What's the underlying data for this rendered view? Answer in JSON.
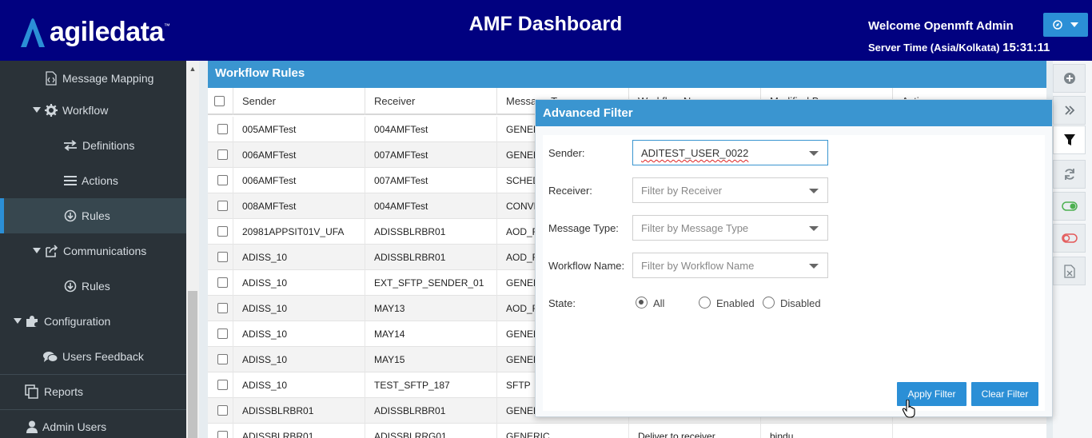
{
  "header": {
    "logo_text": "agiledata",
    "logo_tm": "™",
    "title": "AMF Dashboard",
    "welcome": "Welcome Openmft Admin",
    "server_time_label": "Server Time (Asia/Kolkata)",
    "server_time": "15:31:11",
    "brand_color": "#010180"
  },
  "sidebar": {
    "items": [
      {
        "label": "Message Mapping",
        "icon": "code-file-icon"
      },
      {
        "label": "Workflow",
        "icon": "gear-icon"
      },
      {
        "label": "Definitions",
        "icon": "exchange-arrows-icon"
      },
      {
        "label": "Actions",
        "icon": "list-icon"
      },
      {
        "label": "Rules",
        "icon": "circle-down-icon",
        "active": true
      },
      {
        "label": "Communications",
        "icon": "share-icon"
      },
      {
        "label": "Rules",
        "icon": "circle-down-icon"
      },
      {
        "label": "Configuration",
        "icon": "puzzle-icon"
      },
      {
        "label": "Users Feedback",
        "icon": "comments-icon"
      },
      {
        "label": "Reports",
        "icon": "copy-icon"
      },
      {
        "label": "Admin Users",
        "icon": "user-icon"
      }
    ]
  },
  "panel": {
    "title": "Workflow Rules",
    "columns": [
      "Sender",
      "Receiver",
      "Message Type",
      "Workflow Name",
      "Modified By",
      "Actions"
    ],
    "rows": [
      {
        "sender": "005AMFTest",
        "receiver": "004AMFTest",
        "msg_type": "GENERIC"
      },
      {
        "sender": "006AMFTest",
        "receiver": "007AMFTest",
        "msg_type": "GENERIC"
      },
      {
        "sender": "006AMFTest",
        "receiver": "007AMFTest",
        "msg_type": "SCHEDULER"
      },
      {
        "sender": "008AMFTest",
        "receiver": "004AMFTest",
        "msg_type": "CONVERSION"
      },
      {
        "sender": "20981APPSIT01V_UFA",
        "receiver": "ADISSBLRBR01",
        "msg_type": "AOD_FILE"
      },
      {
        "sender": "ADISS_10",
        "receiver": "ADISSBLRBR01",
        "msg_type": "AOD_FILE"
      },
      {
        "sender": "ADISS_10",
        "receiver": "EXT_SFTP_SENDER_01",
        "msg_type": "GENERIC"
      },
      {
        "sender": "ADISS_10",
        "receiver": "MAY13",
        "msg_type": "AOD_FILE"
      },
      {
        "sender": "ADISS_10",
        "receiver": "MAY14",
        "msg_type": "GENERIC"
      },
      {
        "sender": "ADISS_10",
        "receiver": "MAY15",
        "msg_type": "GENERIC"
      },
      {
        "sender": "ADISS_10",
        "receiver": "TEST_SFTP_187",
        "msg_type": "SFTP"
      },
      {
        "sender": "ADISSBLRBR01",
        "receiver": "ADISSBLRBR01",
        "msg_type": "GENERIC"
      },
      {
        "sender": "ADISSBLRBR01",
        "receiver": "ADISSBLRRG01",
        "msg_type": "GENERIC",
        "workflow": "Deliver to receiver",
        "modified_by": "bindu"
      }
    ]
  },
  "toolbar": {
    "buttons": [
      "add-icon",
      "double-chevron-right-icon",
      "filter-icon",
      "refresh-icon",
      "toggle-on-icon",
      "toggle-off-icon",
      "excel-icon"
    ]
  },
  "filter_dialog": {
    "title": "Advanced Filter",
    "sender_label": "Sender:",
    "sender_value": "ADITEST_USER_0022",
    "receiver_label": "Receiver:",
    "receiver_placeholder": "Filter by Receiver",
    "msg_type_label": "Message Type:",
    "msg_type_placeholder": "Filter by Message Type",
    "workflow_label": "Workflow Name:",
    "workflow_placeholder": "Filter by Workflow Name",
    "state_label": "State:",
    "state_options": [
      "All",
      "Enabled",
      "Disabled"
    ],
    "state_selected": "All",
    "apply_label": "Apply Filter",
    "clear_label": "Clear Filter"
  }
}
